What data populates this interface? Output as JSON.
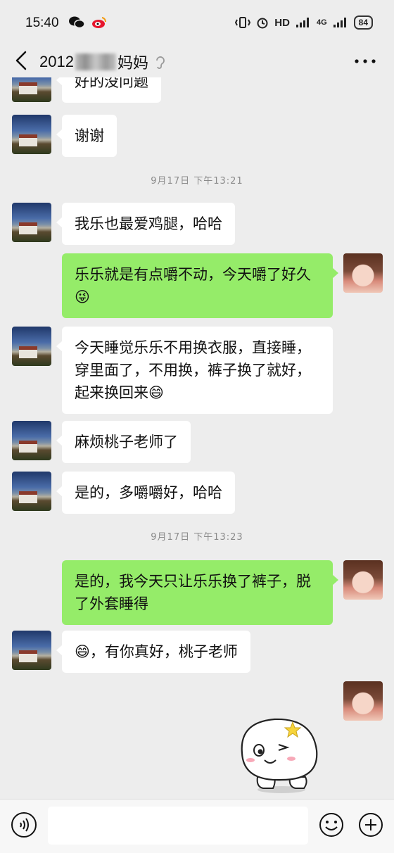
{
  "status_bar": {
    "time": "15:40",
    "network_label": "HD",
    "signal_4g_label": "4G",
    "battery": "84"
  },
  "header": {
    "title_prefix": "2012",
    "title_suffix": "妈妈"
  },
  "messages": [
    {
      "sender": "other",
      "text": "好的没问题"
    },
    {
      "sender": "other",
      "text": "谢谢"
    },
    {
      "type": "timestamp",
      "text": "9月17日 下午13:21"
    },
    {
      "sender": "other",
      "text": "我乐也最爱鸡腿，哈哈"
    },
    {
      "sender": "me",
      "text": "乐乐就是有点嚼不动，今天嚼了好久😜"
    },
    {
      "sender": "other",
      "text": "今天睡觉乐乐不用换衣服，直接睡，穿里面了，不用换，裤子换了就好，起来换回来😄"
    },
    {
      "sender": "other",
      "text": "麻烦桃子老师了"
    },
    {
      "sender": "other",
      "text": "是的，多嚼嚼好，哈哈"
    },
    {
      "type": "timestamp",
      "text": "9月17日 下午13:23"
    },
    {
      "sender": "me",
      "text": "是的，我今天只让乐乐换了裤子，脱了外套睡得"
    },
    {
      "sender": "other",
      "text": "😄，有你真好，桃子老师"
    },
    {
      "sender": "me",
      "type": "sticker",
      "sticker": "winking-bun-sticker"
    }
  ],
  "input": {
    "value": "",
    "placeholder": ""
  },
  "colors": {
    "background": "#ededed",
    "my_bubble": "#95ec69",
    "other_bubble": "#ffffff"
  }
}
